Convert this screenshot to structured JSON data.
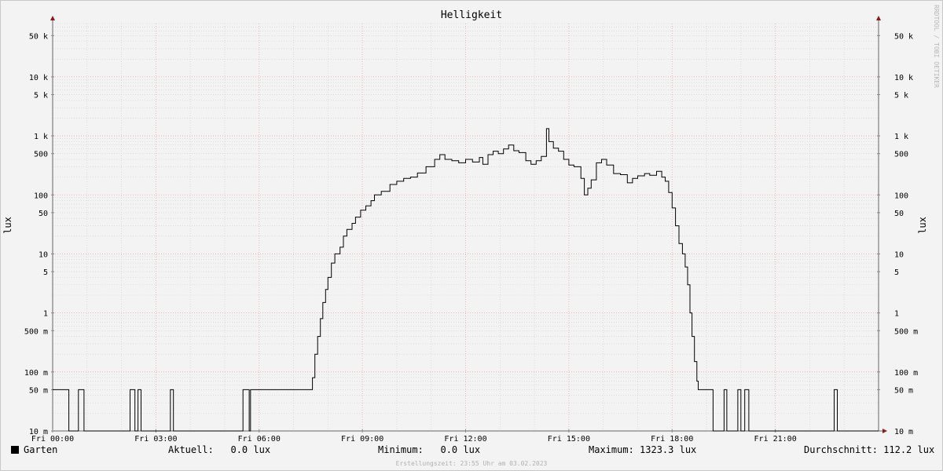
{
  "chart_data": {
    "type": "line",
    "title": "Helligkeit",
    "ylabel": "lux",
    "ylabel_right": "lux",
    "scale": "log",
    "ylim": [
      0.01,
      80000
    ],
    "xlim_hours": [
      0,
      24
    ],
    "yticks": [
      {
        "v": 50000,
        "label": "50 k"
      },
      {
        "v": 10000,
        "label": "10 k"
      },
      {
        "v": 5000,
        "label": "5 k"
      },
      {
        "v": 1000,
        "label": "1 k"
      },
      {
        "v": 500,
        "label": "500"
      },
      {
        "v": 100,
        "label": "100"
      },
      {
        "v": 50,
        "label": "50"
      },
      {
        "v": 10,
        "label": "10"
      },
      {
        "v": 5,
        "label": "5"
      },
      {
        "v": 1,
        "label": "1"
      },
      {
        "v": 0.5,
        "label": "500 m"
      },
      {
        "v": 0.1,
        "label": "100 m"
      },
      {
        "v": 0.05,
        "label": "50 m"
      },
      {
        "v": 0.01,
        "label": "10 m"
      }
    ],
    "xticks": [
      {
        "h": 0,
        "label": "Fri 00:00"
      },
      {
        "h": 3,
        "label": "Fri 03:00"
      },
      {
        "h": 6,
        "label": "Fri 06:00"
      },
      {
        "h": 9,
        "label": "Fri 09:00"
      },
      {
        "h": 12,
        "label": "Fri 12:00"
      },
      {
        "h": 15,
        "label": "Fri 15:00"
      },
      {
        "h": 18,
        "label": "Fri 18:00"
      },
      {
        "h": 21,
        "label": "Fri 21:00"
      }
    ],
    "series": [
      {
        "name": "Garten",
        "color": "#000000",
        "points": [
          [
            0.0,
            0.05
          ],
          [
            0.46,
            0.05
          ],
          [
            0.47,
            0.01
          ],
          [
            0.74,
            0.01
          ],
          [
            0.75,
            0.05
          ],
          [
            0.9,
            0.05
          ],
          [
            0.91,
            0.01
          ],
          [
            2.24,
            0.01
          ],
          [
            2.25,
            0.05
          ],
          [
            2.38,
            0.05
          ],
          [
            2.39,
            0.01
          ],
          [
            2.47,
            0.01
          ],
          [
            2.48,
            0.05
          ],
          [
            2.56,
            0.05
          ],
          [
            2.57,
            0.01
          ],
          [
            3.41,
            0.01
          ],
          [
            3.42,
            0.05
          ],
          [
            3.5,
            0.05
          ],
          [
            3.51,
            0.01
          ],
          [
            5.52,
            0.01
          ],
          [
            5.53,
            0.05
          ],
          [
            5.7,
            0.05
          ],
          [
            5.71,
            0.01
          ],
          [
            5.74,
            0.01
          ],
          [
            5.75,
            0.05
          ],
          [
            7.5,
            0.05
          ],
          [
            7.55,
            0.08
          ],
          [
            7.62,
            0.2
          ],
          [
            7.7,
            0.4
          ],
          [
            7.78,
            0.8
          ],
          [
            7.85,
            1.5
          ],
          [
            7.93,
            2.5
          ],
          [
            8.0,
            4
          ],
          [
            8.1,
            7
          ],
          [
            8.2,
            10
          ],
          [
            8.35,
            13
          ],
          [
            8.45,
            20
          ],
          [
            8.55,
            26
          ],
          [
            8.7,
            33
          ],
          [
            8.8,
            42
          ],
          [
            8.95,
            55
          ],
          [
            9.1,
            65
          ],
          [
            9.25,
            80
          ],
          [
            9.35,
            100
          ],
          [
            9.55,
            115
          ],
          [
            9.8,
            150
          ],
          [
            10.0,
            170
          ],
          [
            10.2,
            190
          ],
          [
            10.4,
            200
          ],
          [
            10.6,
            235
          ],
          [
            10.85,
            300
          ],
          [
            11.1,
            400
          ],
          [
            11.25,
            480
          ],
          [
            11.4,
            400
          ],
          [
            11.6,
            380
          ],
          [
            11.8,
            350
          ],
          [
            12.0,
            400
          ],
          [
            12.2,
            360
          ],
          [
            12.4,
            430
          ],
          [
            12.5,
            330
          ],
          [
            12.65,
            480
          ],
          [
            12.8,
            550
          ],
          [
            12.95,
            500
          ],
          [
            13.1,
            600
          ],
          [
            13.25,
            700
          ],
          [
            13.4,
            560
          ],
          [
            13.55,
            520
          ],
          [
            13.75,
            380
          ],
          [
            13.9,
            330
          ],
          [
            14.05,
            380
          ],
          [
            14.2,
            450
          ],
          [
            14.35,
            1323.3
          ],
          [
            14.42,
            800
          ],
          [
            14.55,
            620
          ],
          [
            14.7,
            550
          ],
          [
            14.85,
            400
          ],
          [
            15.0,
            320
          ],
          [
            15.15,
            300
          ],
          [
            15.35,
            190
          ],
          [
            15.45,
            100
          ],
          [
            15.55,
            130
          ],
          [
            15.65,
            180
          ],
          [
            15.8,
            350
          ],
          [
            15.95,
            400
          ],
          [
            16.1,
            320
          ],
          [
            16.3,
            230
          ],
          [
            16.5,
            220
          ],
          [
            16.7,
            160
          ],
          [
            16.85,
            190
          ],
          [
            17.0,
            210
          ],
          [
            17.2,
            230
          ],
          [
            17.35,
            215
          ],
          [
            17.55,
            250
          ],
          [
            17.7,
            200
          ],
          [
            17.8,
            170
          ],
          [
            17.9,
            110
          ],
          [
            18.0,
            60
          ],
          [
            18.1,
            30
          ],
          [
            18.2,
            15
          ],
          [
            18.3,
            10
          ],
          [
            18.38,
            6
          ],
          [
            18.45,
            3
          ],
          [
            18.52,
            1
          ],
          [
            18.58,
            0.4
          ],
          [
            18.65,
            0.15
          ],
          [
            18.72,
            0.07
          ],
          [
            18.76,
            0.05
          ],
          [
            18.9,
            0.05
          ],
          [
            19.18,
            0.05
          ],
          [
            19.19,
            0.01
          ],
          [
            19.5,
            0.01
          ],
          [
            19.51,
            0.05
          ],
          [
            19.58,
            0.05
          ],
          [
            19.59,
            0.01
          ],
          [
            19.9,
            0.01
          ],
          [
            19.91,
            0.05
          ],
          [
            19.99,
            0.05
          ],
          [
            20.0,
            0.01
          ],
          [
            20.1,
            0.01
          ],
          [
            20.11,
            0.05
          ],
          [
            20.22,
            0.05
          ],
          [
            20.23,
            0.01
          ],
          [
            22.7,
            0.01
          ],
          [
            22.71,
            0.05
          ],
          [
            22.79,
            0.05
          ],
          [
            22.8,
            0.01
          ],
          [
            24.0,
            0.01
          ]
        ]
      }
    ]
  },
  "legend": {
    "series_name": "Garten",
    "current_label": "Aktuell:",
    "current_value": "0.0 lux",
    "min_label": "Minimum:",
    "min_value": "0.0 lux",
    "max_label": "Maximum:",
    "max_value": "1323.3 lux",
    "avg_label": "Durchschnitt:",
    "avg_value": "112.2 lux"
  },
  "credit": "Erstellungszeit: 23:55 Uhr am 03.02.2023",
  "watermark": "RRDTOOL / TOBI OETIKER"
}
